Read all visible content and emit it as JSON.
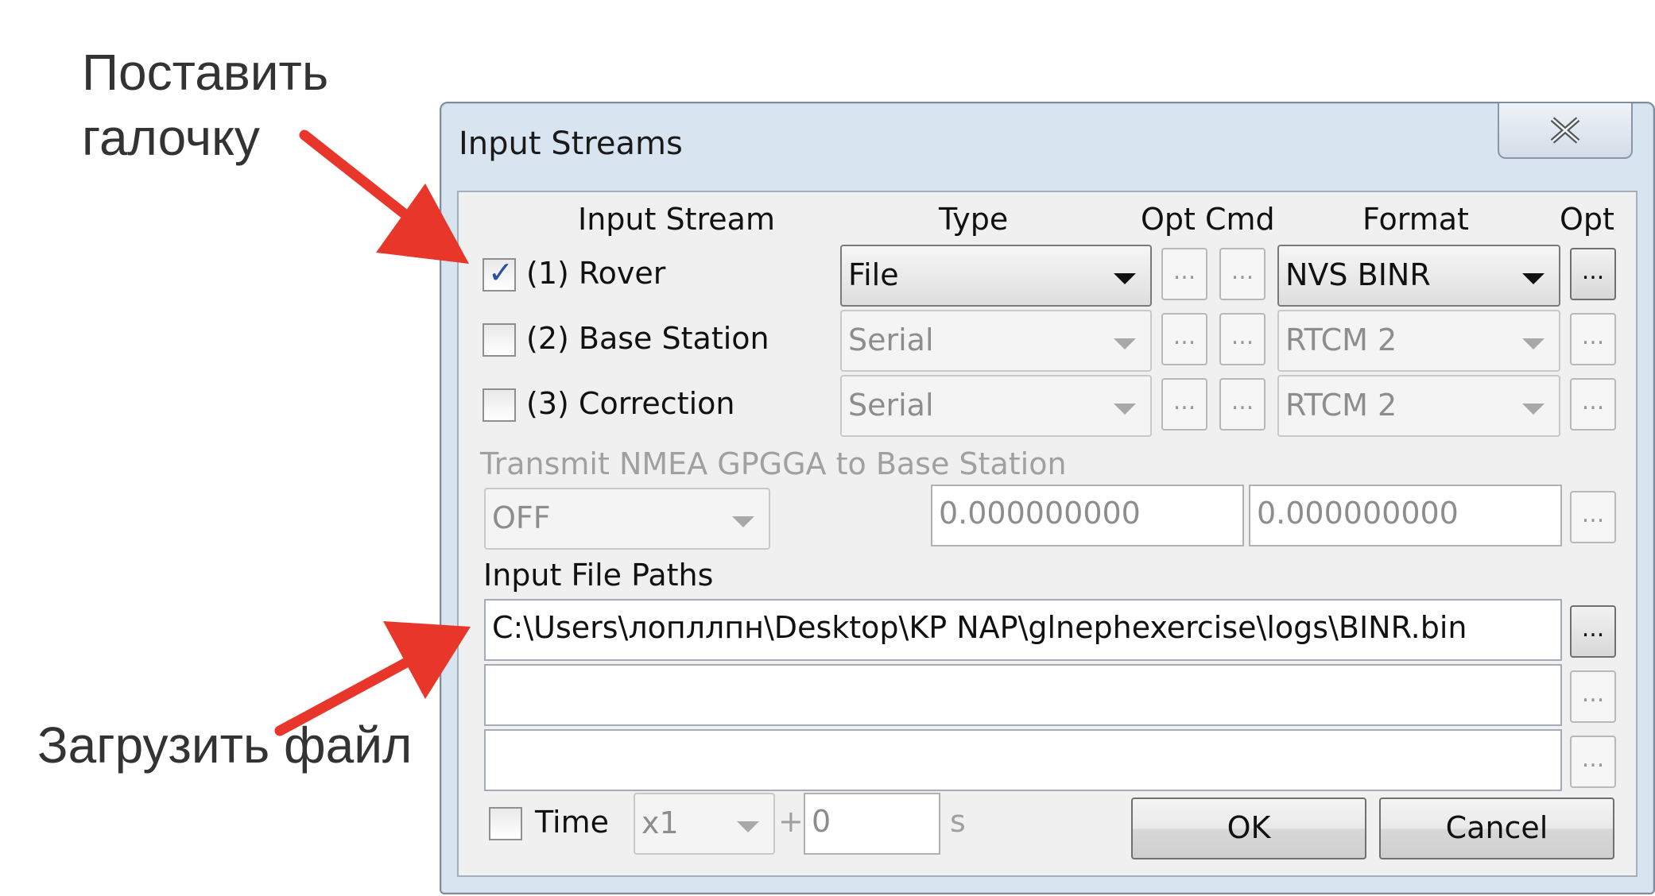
{
  "annotations": {
    "top": [
      "Поставить",
      "галочку"
    ],
    "bottom": "Загрузить файл"
  },
  "dialog": {
    "title": "Input Streams",
    "close_icon": "close-icon"
  },
  "headers": {
    "input_stream": "Input Stream",
    "type": "Type",
    "opt_cmd": "Opt Cmd",
    "format": "Format",
    "opt": "Opt"
  },
  "streams": [
    {
      "label": "(1) Rover",
      "checked": true,
      "type": "File",
      "format": "NVS BINR",
      "enabled": true
    },
    {
      "label": "(2) Base Station",
      "checked": false,
      "type": "Serial",
      "format": "RTCM 2",
      "enabled": false
    },
    {
      "label": "(3) Correction",
      "checked": false,
      "type": "Serial",
      "format": "RTCM 2",
      "enabled": false
    }
  ],
  "ellipsis": "...",
  "nmea": {
    "label": "Transmit NMEA GPGGA to Base Station",
    "mode": "OFF",
    "lat": "0.000000000",
    "lon": "0.000000000"
  },
  "paths": {
    "label": "Input File Paths",
    "values": [
      "C:\\Users\\лопллпн\\Desktop\\KP NAP\\glnephexercise\\logs\\BINR.bin",
      "",
      ""
    ]
  },
  "time": {
    "label": "Time",
    "speed": "x1",
    "plus": "+",
    "offset": "0",
    "unit": "s"
  },
  "buttons": {
    "ok": "OK",
    "cancel": "Cancel"
  },
  "colors": {
    "arrow": "#e8372a",
    "title_bar": "#d9e4f1"
  }
}
